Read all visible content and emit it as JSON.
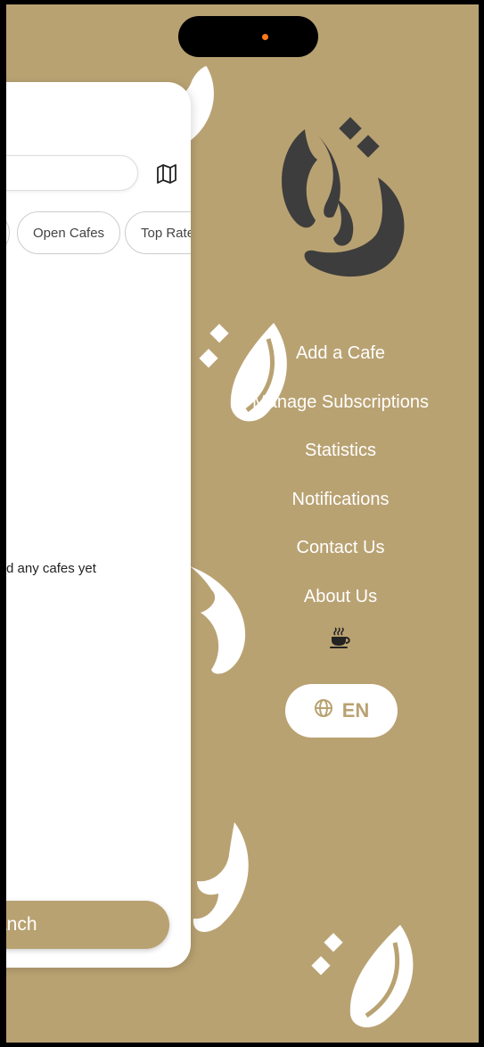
{
  "theme": {
    "background": "#b9a272",
    "white": "#ffffff",
    "logo": "#3d3d3d",
    "accent_dot": "#ff7a1a"
  },
  "panel": {
    "map_icon": "map-icon",
    "chips": [
      {
        "label": ""
      },
      {
        "label": "Open Cafes"
      },
      {
        "label": "Top Rated"
      }
    ],
    "empty_message": "d any cafes yet",
    "branch_button": "Branch"
  },
  "menu": {
    "items": [
      {
        "label": "Add a Cafe"
      },
      {
        "label": "Manage Subscriptions"
      },
      {
        "label": "Statistics"
      },
      {
        "label": "Notifications"
      },
      {
        "label": "Contact Us"
      },
      {
        "label": "About Us"
      }
    ],
    "cup_icon": "coffee-cup-icon",
    "language": {
      "icon": "globe-icon",
      "label": "EN"
    }
  }
}
